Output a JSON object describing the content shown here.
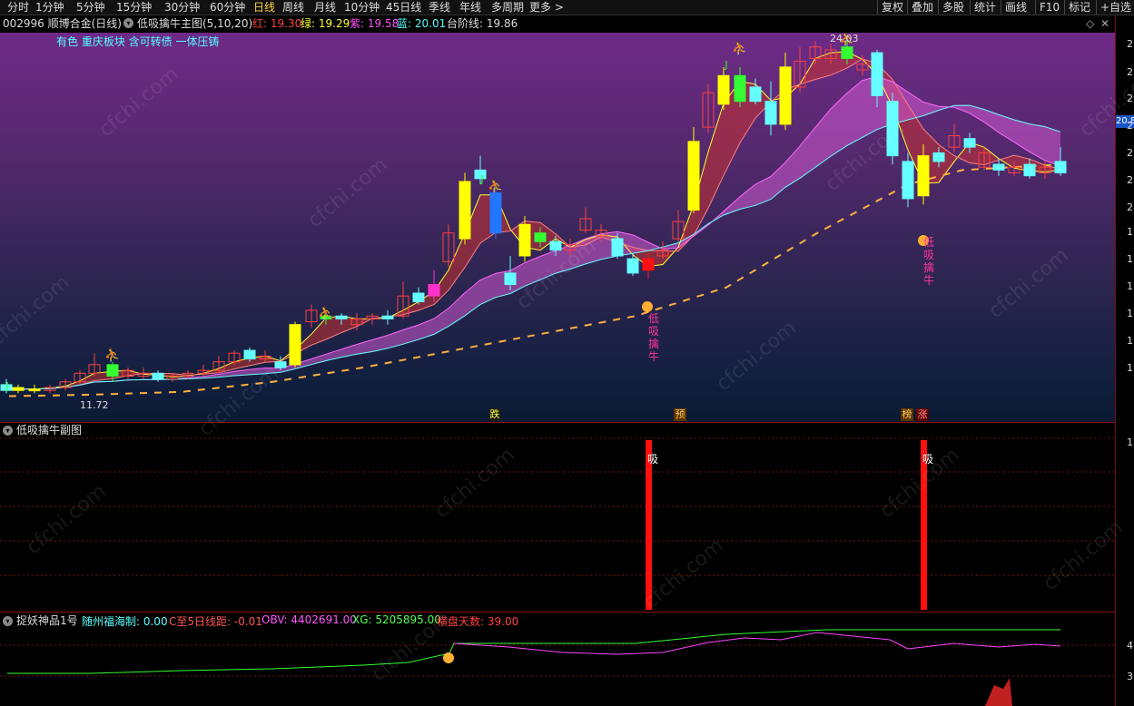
{
  "toolbar": {
    "items": [
      "分时",
      "1分钟",
      "5分钟",
      "15分钟",
      "30分钟",
      "60分钟",
      "日线",
      "周线",
      "月线",
      "10分钟",
      "45日线",
      "季线",
      "年线",
      "多周期",
      "更多 >"
    ],
    "active_index": 6,
    "right_items": [
      "复权",
      "叠加",
      "多股",
      "统计",
      "画线",
      "F10",
      "标记",
      "+自选"
    ]
  },
  "infobar": {
    "stock": "002996 顺博合金(日线)",
    "indicator": "低吸擒牛主图(5,10,20)",
    "red_label": "红: 19.30",
    "green_label": "绿: 19.29",
    "purple_label": "紫: 19.58",
    "blue_label": "蓝: 20.01",
    "step_label": "台阶线: 19.86"
  },
  "main": {
    "sectors": "有色 重庆板块 含可转债 一体压铸",
    "high_label": "24.03",
    "low_label": "11.72",
    "signal_text_1": "低吸擒牛",
    "signal_text_2": "低吸擒牛",
    "bottom_labels": [
      "跌",
      "预",
      "榜",
      "涨"
    ],
    "price_tag": "20.8",
    "axis_ticks": [
      "2",
      "2",
      "2",
      "2",
      "2",
      "2",
      "2",
      "1",
      "1",
      "1",
      "1",
      "1",
      "1"
    ]
  },
  "sub1": {
    "title": "低吸擒牛副图",
    "signal_label_1": "吸",
    "signal_label_2": "吸",
    "axis_tick": "1"
  },
  "sub2": {
    "title": "捉妖神品1号",
    "label_1": "随州福海制: 0.00",
    "label_2": "C至5日线距: -0.01",
    "label_3": "OBV: 4402691.00",
    "label_4": "XG: 5205895.00",
    "label_5": "横盘天数: 39.00",
    "axis_ticks": [
      "4",
      "3"
    ]
  },
  "watermark": "cfchi.com",
  "colors": {
    "red": "#ff3030",
    "green": "#33ff33",
    "purple": "#ff44ff",
    "blue": "#3399ff",
    "cyan": "#55ffff",
    "yellow": "#ffff00",
    "orange": "#ffb050"
  }
}
